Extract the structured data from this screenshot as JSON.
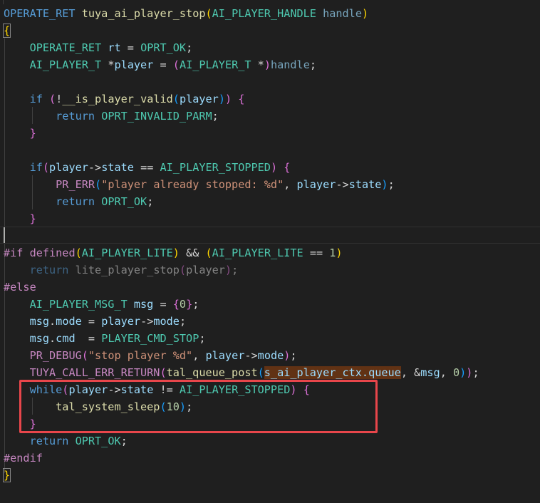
{
  "editor": {
    "language": "c",
    "theme_background": "#1f1f1f",
    "highlight_color": "#e8464b",
    "lines": [
      [
        {
          "c": "k",
          "t": "OPERATE_RET"
        },
        {
          "c": "p",
          "t": " "
        },
        {
          "c": "f",
          "t": "tuya_ai_player_stop"
        },
        {
          "c": "b1",
          "t": "("
        },
        {
          "c": "t",
          "t": "AI_PLAYER_HANDLE"
        },
        {
          "c": "p",
          "t": " "
        },
        {
          "c": "param",
          "t": "handle"
        },
        {
          "c": "b1",
          "t": ")"
        }
      ],
      [
        {
          "c": "b1",
          "t": "{",
          "bm": true
        }
      ],
      [
        {
          "c": "p",
          "t": "    "
        },
        {
          "c": "t",
          "t": "OPERATE_RET"
        },
        {
          "c": "p",
          "t": " "
        },
        {
          "c": "v",
          "t": "rt"
        },
        {
          "c": "p",
          "t": " = "
        },
        {
          "c": "c",
          "t": "OPRT_OK"
        },
        {
          "c": "p",
          "t": ";"
        }
      ],
      [
        {
          "c": "p",
          "t": "    "
        },
        {
          "c": "t",
          "t": "AI_PLAYER_T"
        },
        {
          "c": "p",
          "t": " *"
        },
        {
          "c": "v",
          "t": "player"
        },
        {
          "c": "p",
          "t": " = "
        },
        {
          "c": "b2",
          "t": "("
        },
        {
          "c": "t",
          "t": "AI_PLAYER_T"
        },
        {
          "c": "p",
          "t": " *"
        },
        {
          "c": "b2",
          "t": ")"
        },
        {
          "c": "param",
          "t": "handle"
        },
        {
          "c": "p",
          "t": ";"
        }
      ],
      [],
      [
        {
          "c": "p",
          "t": "    "
        },
        {
          "c": "k",
          "t": "if"
        },
        {
          "c": "p",
          "t": " "
        },
        {
          "c": "b2",
          "t": "("
        },
        {
          "c": "p",
          "t": "!"
        },
        {
          "c": "f",
          "t": "__is_player_valid"
        },
        {
          "c": "b3",
          "t": "("
        },
        {
          "c": "v",
          "t": "player"
        },
        {
          "c": "b3",
          "t": ")"
        },
        {
          "c": "b2",
          "t": ")"
        },
        {
          "c": "p",
          "t": " "
        },
        {
          "c": "b2",
          "t": "{"
        }
      ],
      [
        {
          "c": "p",
          "t": "        "
        },
        {
          "c": "k",
          "t": "return"
        },
        {
          "c": "p",
          "t": " "
        },
        {
          "c": "c",
          "t": "OPRT_INVALID_PARM"
        },
        {
          "c": "p",
          "t": ";"
        }
      ],
      [
        {
          "c": "p",
          "t": "    "
        },
        {
          "c": "b2",
          "t": "}"
        }
      ],
      [],
      [
        {
          "c": "p",
          "t": "    "
        },
        {
          "c": "k",
          "t": "if"
        },
        {
          "c": "b2",
          "t": "("
        },
        {
          "c": "v",
          "t": "player"
        },
        {
          "c": "p",
          "t": "->"
        },
        {
          "c": "v",
          "t": "state"
        },
        {
          "c": "p",
          "t": " == "
        },
        {
          "c": "c",
          "t": "AI_PLAYER_STOPPED"
        },
        {
          "c": "b2",
          "t": ")"
        },
        {
          "c": "p",
          "t": " "
        },
        {
          "c": "b2",
          "t": "{"
        }
      ],
      [
        {
          "c": "p",
          "t": "        "
        },
        {
          "c": "pp",
          "t": "PR_ERR"
        },
        {
          "c": "b3",
          "t": "("
        },
        {
          "c": "s",
          "t": "\"player already stopped: %d\""
        },
        {
          "c": "p",
          "t": ", "
        },
        {
          "c": "v",
          "t": "player"
        },
        {
          "c": "p",
          "t": "->"
        },
        {
          "c": "v",
          "t": "state"
        },
        {
          "c": "b3",
          "t": ")"
        },
        {
          "c": "p",
          "t": ";"
        }
      ],
      [
        {
          "c": "p",
          "t": "        "
        },
        {
          "c": "k",
          "t": "return"
        },
        {
          "c": "p",
          "t": " "
        },
        {
          "c": "c",
          "t": "OPRT_OK"
        },
        {
          "c": "p",
          "t": ";"
        }
      ],
      [
        {
          "c": "p",
          "t": "    "
        },
        {
          "c": "b2",
          "t": "}"
        }
      ],
      [],
      [
        {
          "c": "pp",
          "t": "#if"
        },
        {
          "c": "p",
          "t": " "
        },
        {
          "c": "pp",
          "t": "defined"
        },
        {
          "c": "b1",
          "t": "("
        },
        {
          "c": "c",
          "t": "AI_PLAYER_LITE"
        },
        {
          "c": "b1",
          "t": ")"
        },
        {
          "c": "p",
          "t": " && "
        },
        {
          "c": "b1",
          "t": "("
        },
        {
          "c": "c",
          "t": "AI_PLAYER_LITE"
        },
        {
          "c": "p",
          "t": " == "
        },
        {
          "c": "n",
          "t": "1"
        },
        {
          "c": "b1",
          "t": ")"
        }
      ],
      [
        {
          "c": "p dim",
          "t": "    "
        },
        {
          "c": "k dim",
          "t": "return"
        },
        {
          "c": "p dim",
          "t": " lite_player_stop"
        },
        {
          "c": "b2 dim",
          "t": "("
        },
        {
          "c": "p dim",
          "t": "player"
        },
        {
          "c": "b2 dim",
          "t": ")"
        },
        {
          "c": "p dim",
          "t": ";"
        }
      ],
      [
        {
          "c": "pp",
          "t": "#else"
        }
      ],
      [
        {
          "c": "p",
          "t": "    "
        },
        {
          "c": "t",
          "t": "AI_PLAYER_MSG_T"
        },
        {
          "c": "p",
          "t": " "
        },
        {
          "c": "v",
          "t": "msg"
        },
        {
          "c": "p",
          "t": " = "
        },
        {
          "c": "b2",
          "t": "{"
        },
        {
          "c": "n",
          "t": "0"
        },
        {
          "c": "b2",
          "t": "}"
        },
        {
          "c": "p",
          "t": ";"
        }
      ],
      [
        {
          "c": "p",
          "t": "    "
        },
        {
          "c": "v",
          "t": "msg"
        },
        {
          "c": "p",
          "t": "."
        },
        {
          "c": "v",
          "t": "mode"
        },
        {
          "c": "p",
          "t": " = "
        },
        {
          "c": "v",
          "t": "player"
        },
        {
          "c": "p",
          "t": "->"
        },
        {
          "c": "v",
          "t": "mode"
        },
        {
          "c": "p",
          "t": ";"
        }
      ],
      [
        {
          "c": "p",
          "t": "    "
        },
        {
          "c": "v",
          "t": "msg"
        },
        {
          "c": "p",
          "t": "."
        },
        {
          "c": "v",
          "t": "cmd"
        },
        {
          "c": "p",
          "t": "  = "
        },
        {
          "c": "c",
          "t": "PLAYER_CMD_STOP"
        },
        {
          "c": "p",
          "t": ";"
        }
      ],
      [
        {
          "c": "p",
          "t": "    "
        },
        {
          "c": "pp",
          "t": "PR_DEBUG"
        },
        {
          "c": "b2",
          "t": "("
        },
        {
          "c": "s",
          "t": "\"stop player %d\""
        },
        {
          "c": "p",
          "t": ", "
        },
        {
          "c": "v",
          "t": "player"
        },
        {
          "c": "p",
          "t": "->"
        },
        {
          "c": "v",
          "t": "mode"
        },
        {
          "c": "b2",
          "t": ")"
        },
        {
          "c": "p",
          "t": ";"
        }
      ],
      [
        {
          "c": "p",
          "t": "    "
        },
        {
          "c": "pp",
          "t": "TUYA_CALL_ERR_RETURN"
        },
        {
          "c": "b2",
          "t": "("
        },
        {
          "c": "f",
          "t": "tal_queue_post"
        },
        {
          "c": "b3",
          "t": "("
        },
        {
          "c": "v find",
          "t": "s_ai_player_ctx.queue"
        },
        {
          "c": "p",
          "t": ", &"
        },
        {
          "c": "v",
          "t": "msg"
        },
        {
          "c": "p",
          "t": ", "
        },
        {
          "c": "n",
          "t": "0"
        },
        {
          "c": "b3",
          "t": ")"
        },
        {
          "c": "b2",
          "t": ")"
        },
        {
          "c": "p",
          "t": ";"
        }
      ],
      [
        {
          "c": "p",
          "t": "    "
        },
        {
          "c": "k",
          "t": "while"
        },
        {
          "c": "b2",
          "t": "("
        },
        {
          "c": "v",
          "t": "player"
        },
        {
          "c": "p",
          "t": "->"
        },
        {
          "c": "v",
          "t": "state"
        },
        {
          "c": "p",
          "t": " != "
        },
        {
          "c": "c",
          "t": "AI_PLAYER_STOPPED"
        },
        {
          "c": "b2",
          "t": ")"
        },
        {
          "c": "p",
          "t": " "
        },
        {
          "c": "b2",
          "t": "{"
        }
      ],
      [
        {
          "c": "p",
          "t": "        "
        },
        {
          "c": "f",
          "t": "tal_system_sleep"
        },
        {
          "c": "b3",
          "t": "("
        },
        {
          "c": "n",
          "t": "10"
        },
        {
          "c": "b3",
          "t": ")"
        },
        {
          "c": "p",
          "t": ";"
        }
      ],
      [
        {
          "c": "p",
          "t": "    "
        },
        {
          "c": "b2",
          "t": "}"
        }
      ],
      [
        {
          "c": "p",
          "t": "    "
        },
        {
          "c": "k",
          "t": "return"
        },
        {
          "c": "p",
          "t": " "
        },
        {
          "c": "c",
          "t": "OPRT_OK"
        },
        {
          "c": "p",
          "t": ";"
        }
      ],
      [
        {
          "c": "pp",
          "t": "#endif"
        }
      ],
      [
        {
          "c": "b1",
          "t": "}",
          "bm": true
        }
      ]
    ]
  }
}
